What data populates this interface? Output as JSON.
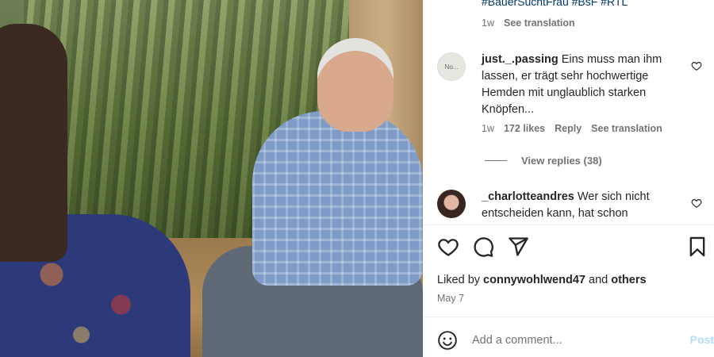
{
  "caption": {
    "hashtags": "#BauerSuchtFrau #BsF #RTL",
    "time": "1w",
    "see_translation": "See translation"
  },
  "comments": [
    {
      "avatar_text": "No...",
      "username": "just._.passing",
      "text": "Eins muss man ihm lassen, er trägt sehr hochwertige Hemden mit unglaublich starken Knöpfen...",
      "time": "1w",
      "likes": "172 likes",
      "reply": "Reply",
      "see_translation": "See translation",
      "view_replies": "View replies (38)"
    },
    {
      "username": "_charlotteandres",
      "text": "Wer sich nicht entscheiden kann, hat schon"
    }
  ],
  "post": {
    "liked_by_prefix": "Liked by",
    "liked_by_user": "connywohlwend47",
    "liked_by_and": "and",
    "liked_by_others": "others",
    "date": "May 7"
  },
  "add_comment": {
    "placeholder": "Add a comment...",
    "post_label": "Post"
  },
  "icons": {
    "like": "heart-icon",
    "comment": "comment-bubble-icon",
    "share": "paper-plane-icon",
    "save": "bookmark-icon",
    "emoji": "smiley-icon"
  },
  "colors": {
    "link": "#00376b",
    "muted": "#737373",
    "post_disabled": "#b3dbff"
  }
}
